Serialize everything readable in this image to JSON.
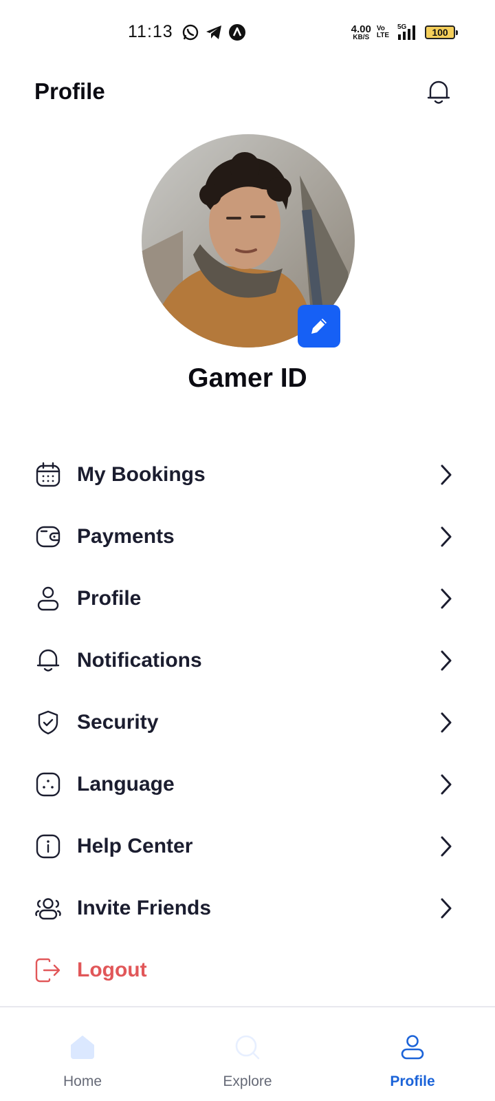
{
  "status_bar": {
    "time": "11:13",
    "net_speed_value": "4.00",
    "net_speed_unit": "KB/S",
    "volte_top": "Vo",
    "volte_bottom": "LTE",
    "network_type": "5G",
    "battery_level": "100",
    "app_icons": [
      "whatsapp-icon",
      "telegram-icon",
      "app-a-icon"
    ]
  },
  "header": {
    "title": "Profile",
    "bell_icon": "bell-icon"
  },
  "profile": {
    "name": "Gamer ID",
    "edit_icon": "pencil-icon"
  },
  "menu": {
    "items": [
      {
        "label": "My Bookings",
        "icon": "calendar-icon"
      },
      {
        "label": "Payments",
        "icon": "wallet-icon"
      },
      {
        "label": "Profile",
        "icon": "user-icon"
      },
      {
        "label": "Notifications",
        "icon": "bell-icon"
      },
      {
        "label": "Security",
        "icon": "shield-check-icon"
      },
      {
        "label": "Language",
        "icon": "language-icon"
      },
      {
        "label": "Help Center",
        "icon": "info-icon"
      },
      {
        "label": "Invite Friends",
        "icon": "users-icon"
      }
    ],
    "logout": {
      "label": "Logout",
      "icon": "logout-icon"
    }
  },
  "colors": {
    "accent": "#1b63d8",
    "edit_button": "#1660f5",
    "logout": "#e15759",
    "text": "#1b1d2f",
    "nav_inactive": "#666a77"
  },
  "bottom_nav": {
    "items": [
      {
        "label": "Home",
        "icon": "home-icon",
        "active": false
      },
      {
        "label": "Explore",
        "icon": "search-icon",
        "active": false
      },
      {
        "label": "Profile",
        "icon": "user-icon",
        "active": true
      }
    ]
  }
}
